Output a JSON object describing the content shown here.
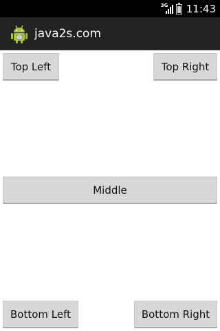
{
  "status_bar": {
    "network_type": "3G",
    "time": "11:43",
    "battery_level": 0.7,
    "signal_icon": "signal-icon",
    "battery_icon": "battery-icon"
  },
  "action_bar": {
    "title": "java2s.com",
    "icon": "android-launcher-icon"
  },
  "buttons": {
    "top_left": "Top Left",
    "top_right": "Top Right",
    "middle": "Middle",
    "bottom_left": "Bottom Left",
    "bottom_right": "Bottom Right"
  },
  "colors": {
    "status_bar": "#000000",
    "action_bar": "#222222",
    "button_bg": "#d8d8d8",
    "android_green": "#a4c639"
  }
}
